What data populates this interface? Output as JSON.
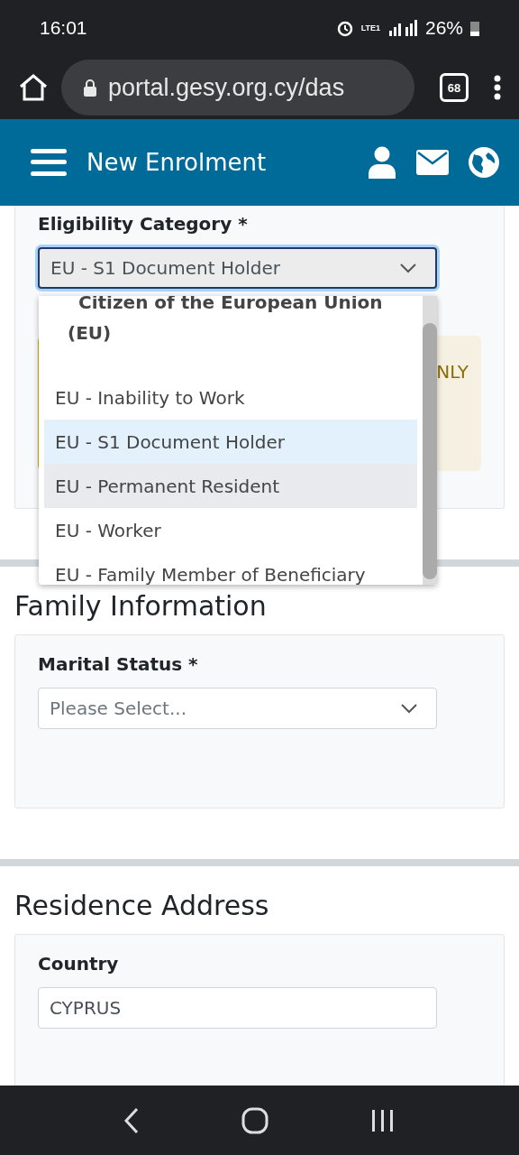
{
  "status_bar": {
    "time": "16:01",
    "network": "LTE1",
    "battery": "26%",
    "tabs_count": "68"
  },
  "browser": {
    "url": "portal.gesy.org.cy/das"
  },
  "header": {
    "title": "New Enrolment"
  },
  "eligibility": {
    "label": "Eligibility Category *",
    "value": "EU - S1 Document Holder",
    "notice": "NLY",
    "dropdown": [
      {
        "kind": "group",
        "label": "Citizen of the European Union (EU)"
      },
      {
        "kind": "option",
        "label": "EU - Inability to Work",
        "selected": false,
        "hovered": false
      },
      {
        "kind": "option",
        "label": "EU - S1 Document Holder",
        "selected": true,
        "hovered": false
      },
      {
        "kind": "option",
        "label": "EU - Permanent Resident",
        "selected": false,
        "hovered": true
      },
      {
        "kind": "option",
        "label": "EU - Worker",
        "selected": false,
        "hovered": false
      },
      {
        "kind": "option",
        "label": "EU - Family Member of Beneficiary",
        "selected": false,
        "hovered": false
      }
    ]
  },
  "family": {
    "title": "Family Information",
    "label": "Marital Status *",
    "placeholder": "Please Select..."
  },
  "residence": {
    "title": "Residence Address",
    "label": "Country",
    "value": "CYPRUS"
  }
}
